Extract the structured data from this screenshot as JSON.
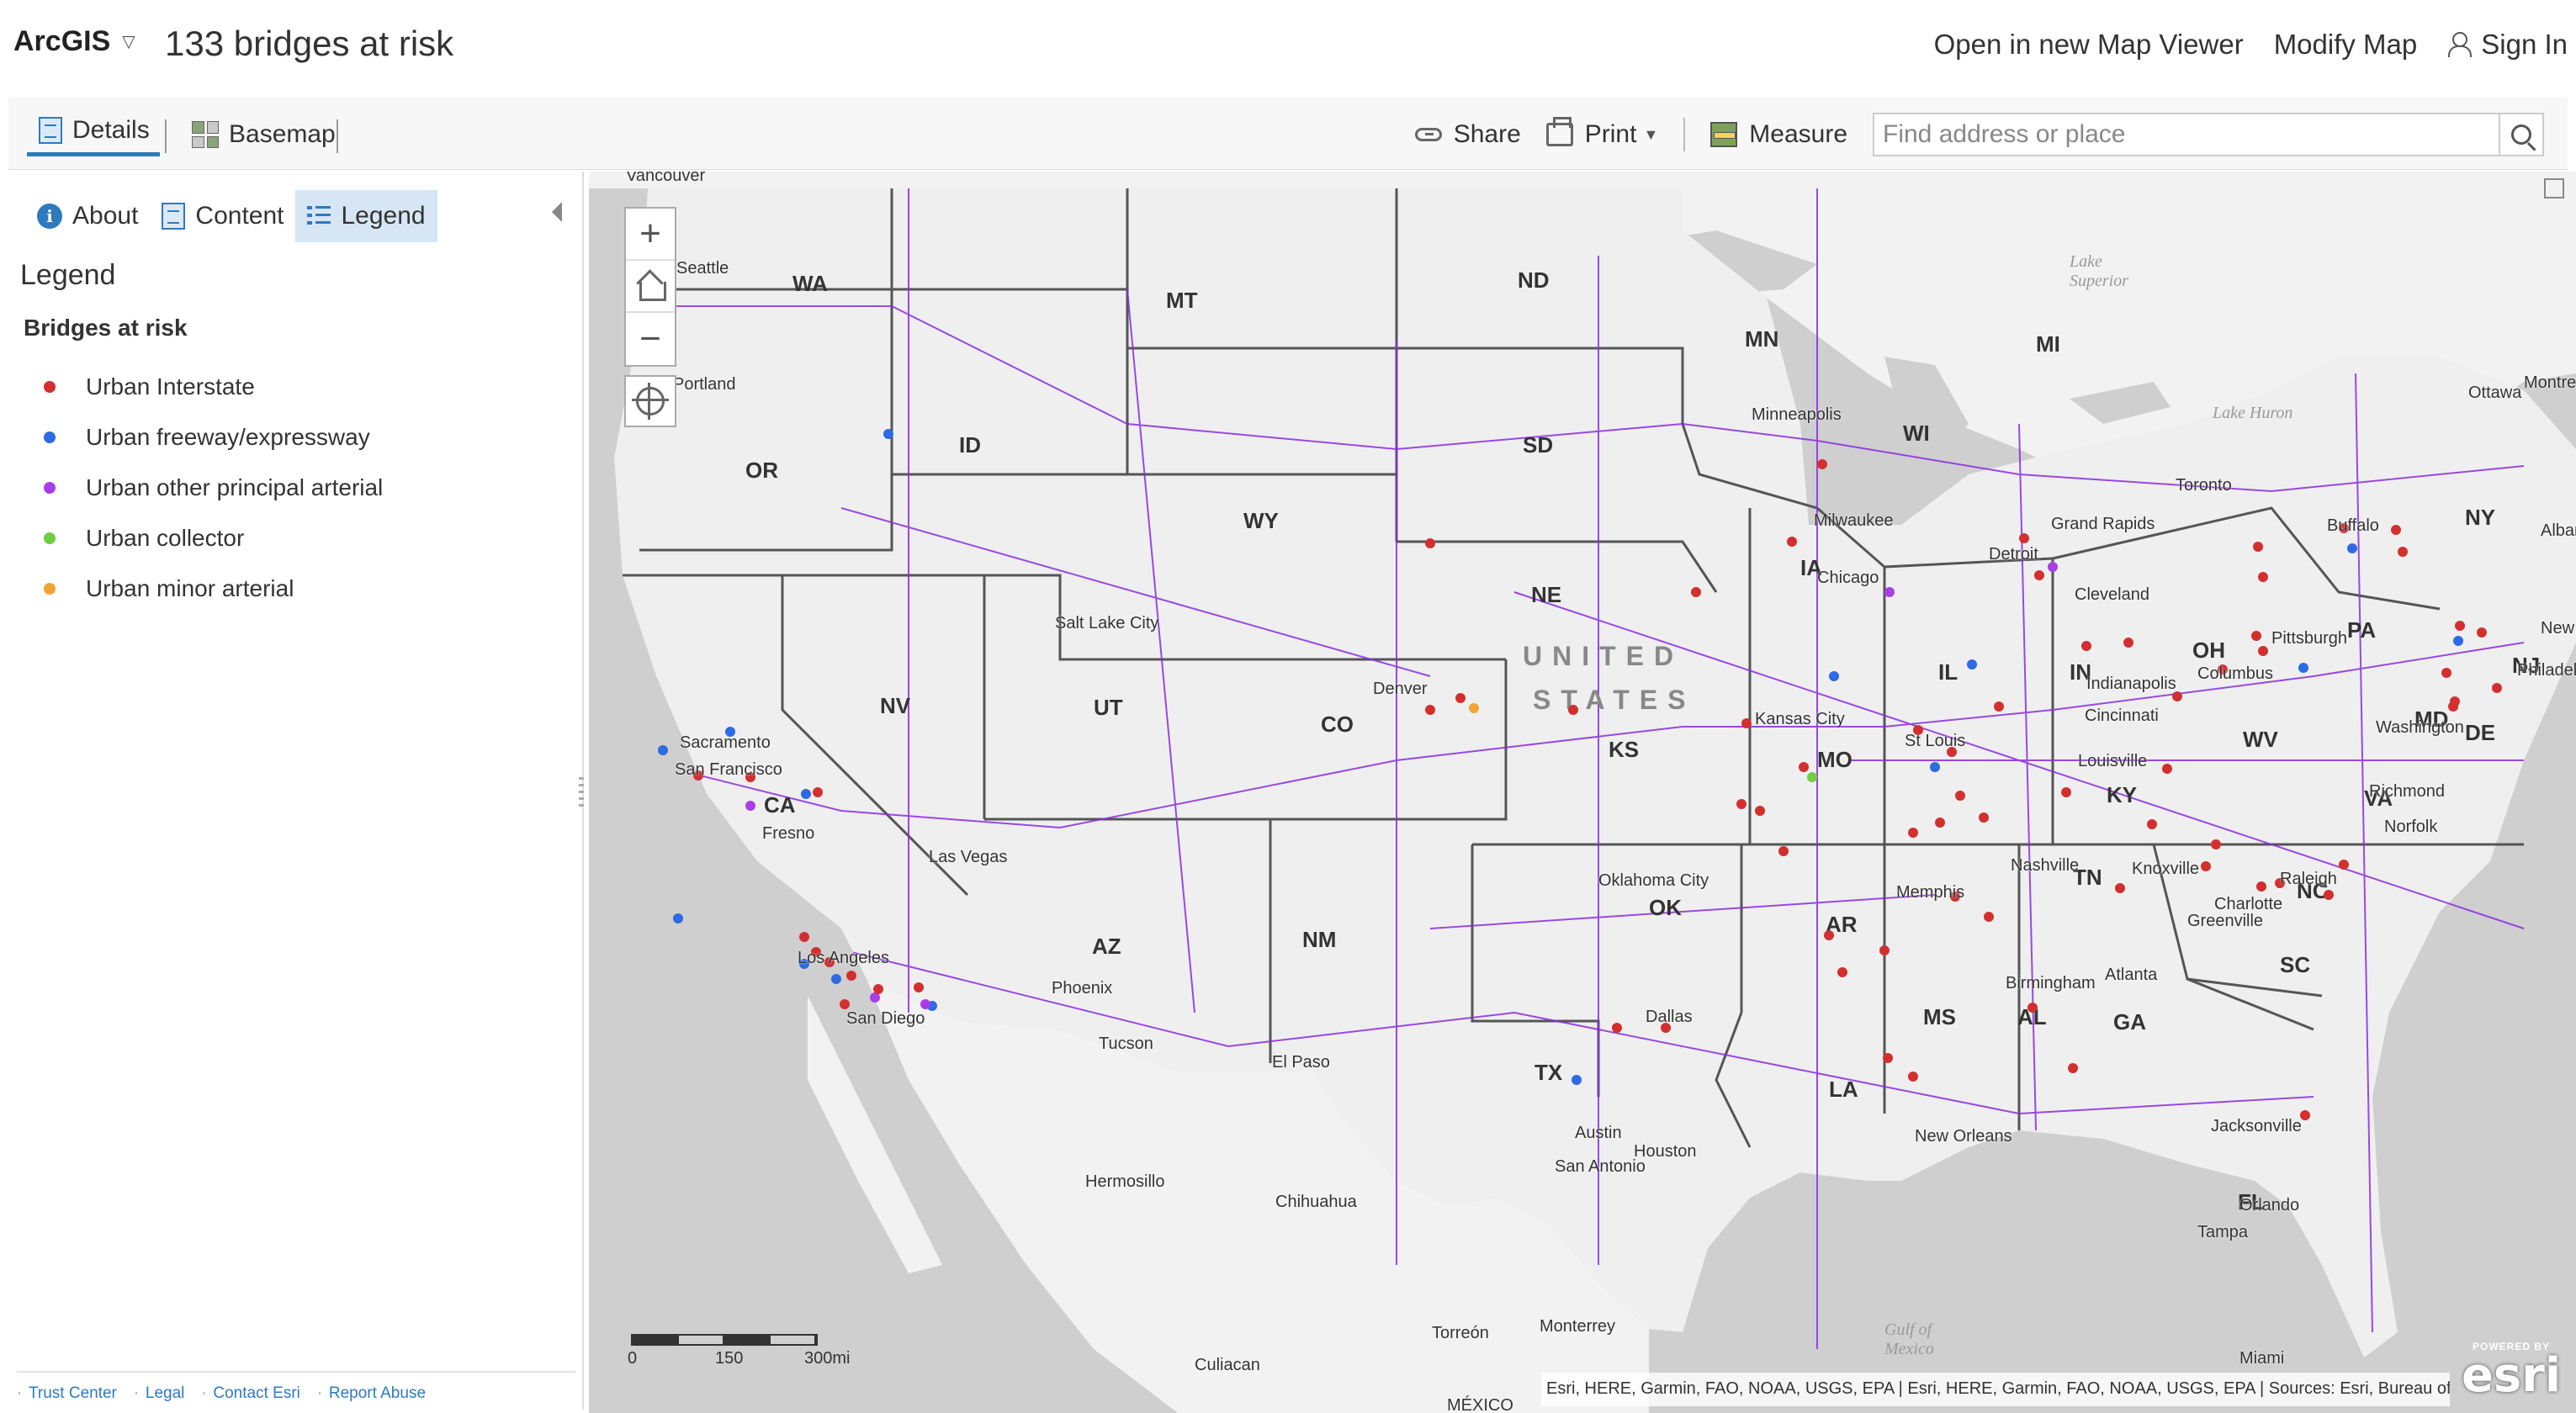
{
  "header": {
    "brand": "ArcGIS",
    "map_title": "133 bridges at risk",
    "links": [
      "Open in new Map Viewer",
      "Modify Map",
      "Sign In"
    ]
  },
  "toolbar": {
    "details_label": "Details",
    "basemap_label": "Basemap",
    "share_label": "Share",
    "print_label": "Print",
    "measure_label": "Measure",
    "search_placeholder": "Find address or place"
  },
  "panel": {
    "tabs": [
      "About",
      "Content",
      "Legend"
    ],
    "active_tab": "Legend",
    "legend_heading": "Legend",
    "layer_title": "Bridges at risk",
    "legend_items": [
      {
        "label": "Urban Interstate",
        "color": "#d32f2f"
      },
      {
        "label": "Urban freeway/expressway",
        "color": "#2d6ae3"
      },
      {
        "label": "Urban other principal arterial",
        "color": "#a83ee6"
      },
      {
        "label": "Urban collector",
        "color": "#6fcf3f"
      },
      {
        "label": "Urban minor arterial",
        "color": "#f0a533"
      }
    ],
    "footer_links": [
      "Trust Center",
      "Legal",
      "Contact Esri",
      "Report Abuse"
    ]
  },
  "map": {
    "zoom_in": "+",
    "zoom_out": "−",
    "scale": {
      "labels": [
        "0",
        "150",
        "300mi"
      ]
    },
    "attribution": "Esri, HERE, Garmin, FAO, NOAA, USGS, EPA | Esri, HERE, Garmin, FAO, NOAA, USGS, EPA | Sources: Esri, Bureau of...",
    "esri_powered": "POWERED BY",
    "esri_word": "esri",
    "country_label": [
      "UNITED",
      "STATES"
    ],
    "state_labels": [
      "WA",
      "MT",
      "ND",
      "MN",
      "OR",
      "ID",
      "SD",
      "WY",
      "WI",
      "MI",
      "NE",
      "IA",
      "NV",
      "UT",
      "CO",
      "KS",
      "MO",
      "IL",
      "IN",
      "OH",
      "PA",
      "NY",
      "CA",
      "KY",
      "WV",
      "VA",
      "AZ",
      "NM",
      "OK",
      "TN",
      "NC",
      "AR",
      "SC",
      "MS",
      "AL",
      "GA",
      "TX",
      "LA",
      "FL",
      "DE",
      "MD",
      "NJ"
    ],
    "city_labels": [
      "Vancouver",
      "Seattle",
      "Portland",
      "Minneapolis",
      "Milwaukee",
      "Chicago",
      "Detroit",
      "Cleveland",
      "Toronto",
      "Ottawa",
      "Montreal",
      "Buffalo",
      "Albany",
      "New York",
      "Philadelphia",
      "Pittsburgh",
      "Columbus",
      "Indianapolis",
      "Cincinnati",
      "Louisville",
      "St Louis",
      "Kansas City",
      "Denver",
      "Salt Lake City",
      "Sacramento",
      "San Francisco",
      "Fresno",
      "Las Vegas",
      "Los Angeles",
      "San Diego",
      "Phoenix",
      "Tucson",
      "El Paso",
      "Oklahoma City",
      "Dallas",
      "Austin",
      "San Antonio",
      "Houston",
      "New Orleans",
      "Memphis",
      "Nashville",
      "Knoxville",
      "Charlotte",
      "Raleigh",
      "Greenville",
      "Atlanta",
      "Birmingham",
      "Jacksonville",
      "Orlando",
      "Tampa",
      "Miami",
      "Washington",
      "Richmond",
      "Norfolk",
      "Grand Rapids",
      "Hermosillo",
      "Chihuahua",
      "Torreón",
      "Monterrey",
      "Culiacan",
      "MÉXICO"
    ],
    "water_labels": [
      "Lake Superior",
      "Lake Huron",
      "Gulf of Mexico"
    ]
  }
}
